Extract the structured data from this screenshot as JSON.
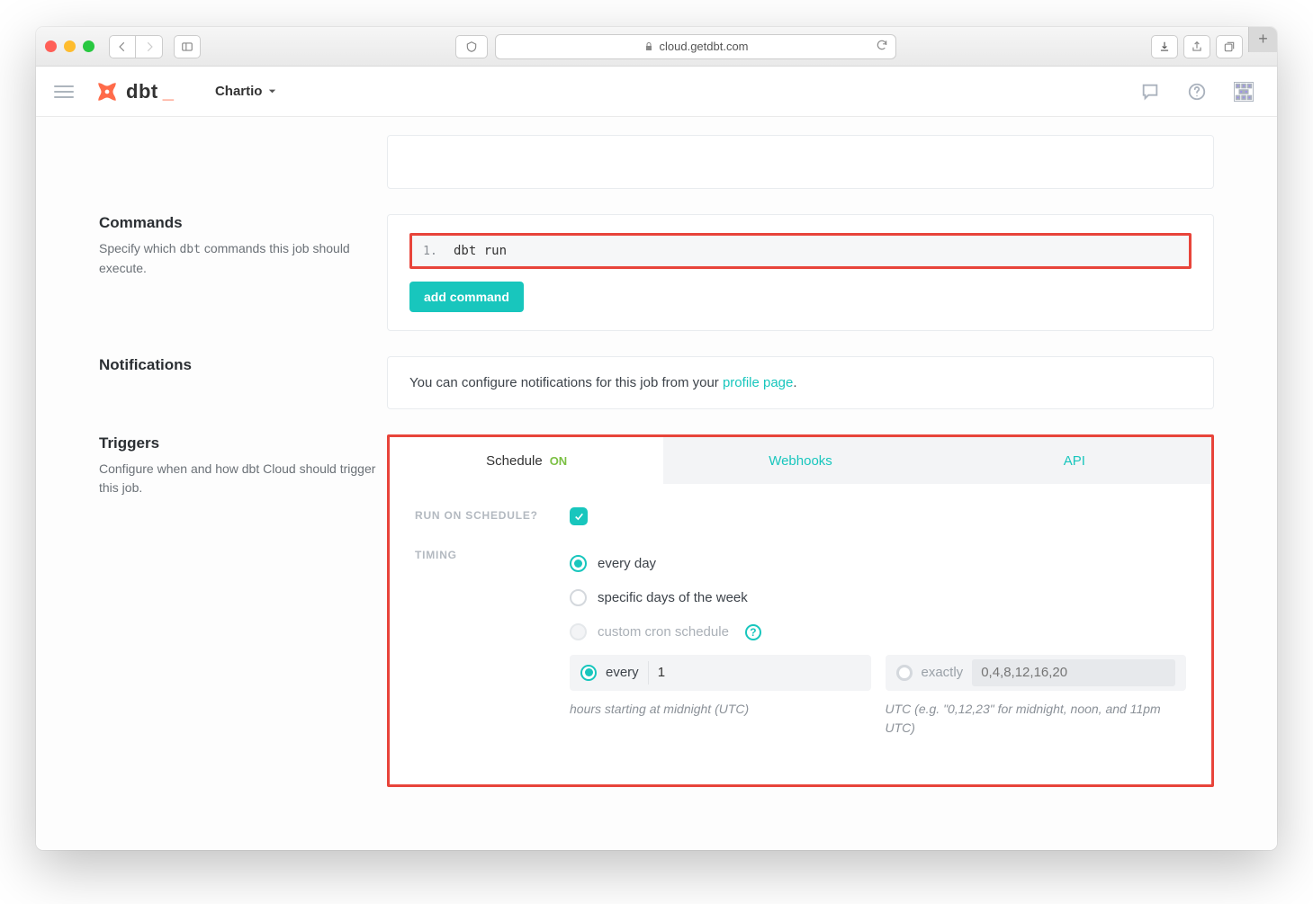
{
  "browser": {
    "url": "cloud.getdbt.com"
  },
  "header": {
    "brand": "dbt",
    "org": "Chartio"
  },
  "commands": {
    "title": "Commands",
    "desc_pre": "Specify which ",
    "desc_code": "dbt",
    "desc_post": " commands this job should execute.",
    "items": [
      {
        "num": "1.",
        "text": "dbt run"
      }
    ],
    "add_btn": "add command"
  },
  "notifications": {
    "title": "Notifications",
    "text_pre": "You can configure notifications for this job from your ",
    "link": "profile page",
    "text_post": "."
  },
  "triggers": {
    "title": "Triggers",
    "desc": "Configure when and how dbt Cloud should trigger this job.",
    "tabs": {
      "schedule": "Schedule",
      "schedule_state": "ON",
      "webhooks": "Webhooks",
      "api": "API"
    },
    "run_on_schedule_label": "Run on schedule?",
    "timing_label": "Timing",
    "timing_options": {
      "every_day": "every day",
      "specific_days": "specific days of the week",
      "custom_cron": "custom cron schedule"
    },
    "frequency": {
      "every_label": "every",
      "every_value": "1",
      "every_hint": "hours starting at midnight (UTC)",
      "exactly_label": "exactly",
      "exactly_placeholder": "0,4,8,12,16,20",
      "exactly_hint": "UTC (e.g. \"0,12,23\" for midnight, noon, and 11pm UTC)"
    }
  }
}
